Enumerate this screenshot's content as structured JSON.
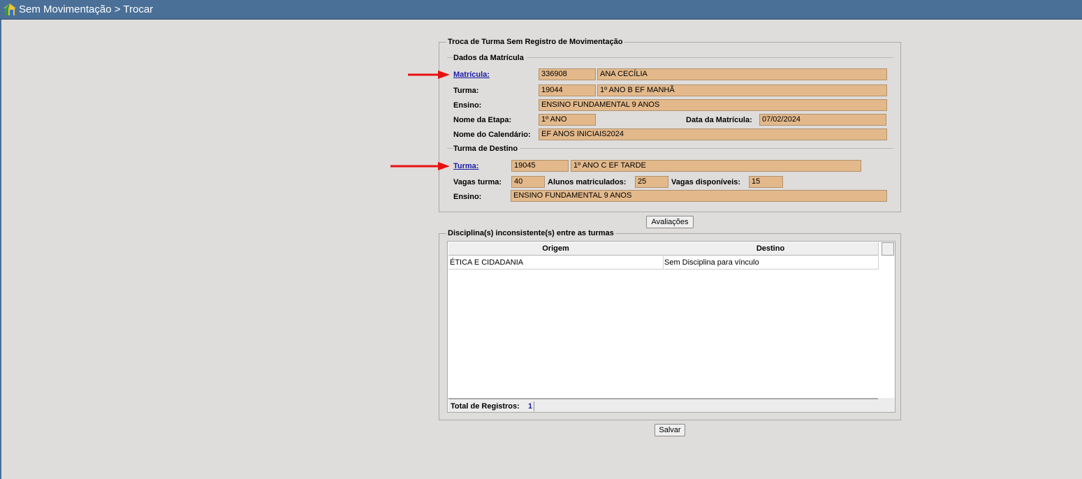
{
  "window": {
    "title": "Sem Movimentação > Trocar"
  },
  "form": {
    "legend": "Troca de Turma Sem Registro de Movimentação",
    "matricula_section": {
      "heading": "Dados da Matrícula",
      "matricula_label": "Matrícula:",
      "matricula_code": "336908",
      "aluno_nome": "ANA CECÍLIA",
      "turma_label": "Turma:",
      "turma_code": "19044",
      "turma_nome": "1º ANO B EF MANHÃ",
      "ensino_label": "Ensino:",
      "ensino_value": "ENSINO FUNDAMENTAL 9 ANOS",
      "etapa_label": "Nome da Etapa:",
      "etapa_value": "1º ANO",
      "data_label": "Data da Matrícula:",
      "data_value": "07/02/2024",
      "calendario_label": "Nome do Calendário:",
      "calendario_value": "EF ANOS INICIAIS2024"
    },
    "destino_section": {
      "heading": "Turma de Destino",
      "turma_label": "Turma:",
      "turma_code": "19045",
      "turma_nome": "1º ANO C EF TARDE",
      "vagas_label": "Vagas turma:",
      "vagas_value": "40",
      "alunos_label": "Alunos matriculados:",
      "alunos_value": "25",
      "disponiveis_label": "Vagas disponíveis:",
      "disponiveis_value": "15",
      "ensino_label": "Ensino:",
      "ensino_value": "ENSINO FUNDAMENTAL 9 ANOS"
    }
  },
  "buttons": {
    "avaliacoes": "Avaliações",
    "salvar": "Salvar"
  },
  "disciplinas": {
    "legend": "Disciplina(s) inconsistente(s) entre as turmas",
    "columns": [
      "Origem",
      "Destino"
    ],
    "rows": [
      {
        "origem": "ÉTICA E CIDADANIA",
        "destino": "Sem Disciplina para vínculo"
      }
    ],
    "total_label": "Total de Registros:",
    "total_value": "1"
  },
  "colors": {
    "titlebar": "#4a7098",
    "field_bg": "#e3b98b",
    "arrow": "#e81010",
    "link": "#1a1aa6"
  }
}
